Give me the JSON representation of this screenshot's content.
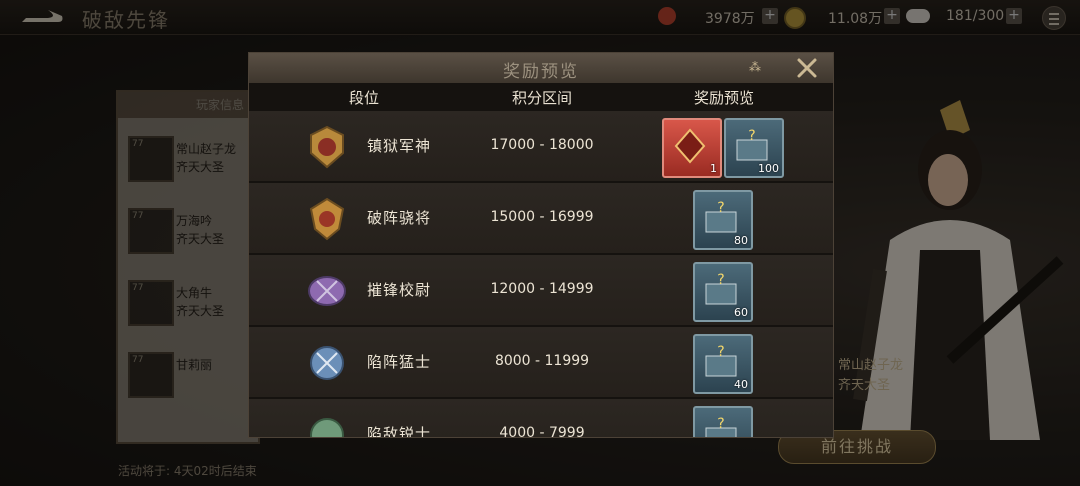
{
  "topbar": {
    "title": "破敌先锋",
    "resources": [
      {
        "name": "currency-1",
        "value": "3978万"
      },
      {
        "name": "currency-2",
        "value": "11.08万"
      },
      {
        "name": "stamina",
        "value": "181/300"
      }
    ],
    "plus_label": "+"
  },
  "left_panel": {
    "header": "玩家信息",
    "players": [
      {
        "level": "77",
        "name": "常山赵子龙",
        "title": "齐天大圣"
      },
      {
        "level": "77",
        "name": "万海吟",
        "title": "齐天大圣"
      },
      {
        "level": "77",
        "name": "大角牛",
        "title": "齐天大圣"
      },
      {
        "level": "77",
        "name": "甘莉丽",
        "title": ""
      }
    ]
  },
  "event_end": "活动将于: 4天02时后结束",
  "hero": {
    "name": "常山赵子龙",
    "title": "齐天大圣"
  },
  "go_button": "前往挑战",
  "modal": {
    "title": "奖励预览",
    "columns": {
      "rank": "段位",
      "score": "积分区间",
      "reward": "奖励预览"
    },
    "rows": [
      {
        "rank": "镇狱军神",
        "range": "17000 - 18000",
        "rewards": [
          {
            "type": "token",
            "qty": "1"
          },
          {
            "type": "box",
            "qty": "100"
          }
        ],
        "badge_color": "#b8893b"
      },
      {
        "rank": "破阵骁将",
        "range": "15000 - 16999",
        "rewards": [
          {
            "type": "box",
            "qty": "80"
          }
        ],
        "badge_color": "#c08a3a"
      },
      {
        "rank": "摧锋校尉",
        "range": "12000 - 14999",
        "rewards": [
          {
            "type": "box",
            "qty": "60"
          }
        ],
        "badge_color": "#8e6ab0"
      },
      {
        "rank": "陷阵猛士",
        "range": "8000 - 11999",
        "rewards": [
          {
            "type": "box",
            "qty": "40"
          }
        ],
        "badge_color": "#6b8fb8"
      },
      {
        "rank": "陷敌锐士",
        "range": "4000 - 7999",
        "rewards": [
          {
            "type": "box",
            "qty": ""
          }
        ],
        "badge_color": "#6f9a7a"
      }
    ]
  },
  "colors": {
    "accent": "#cbb994",
    "token": "#c0392b",
    "box": "#3b5a69"
  }
}
